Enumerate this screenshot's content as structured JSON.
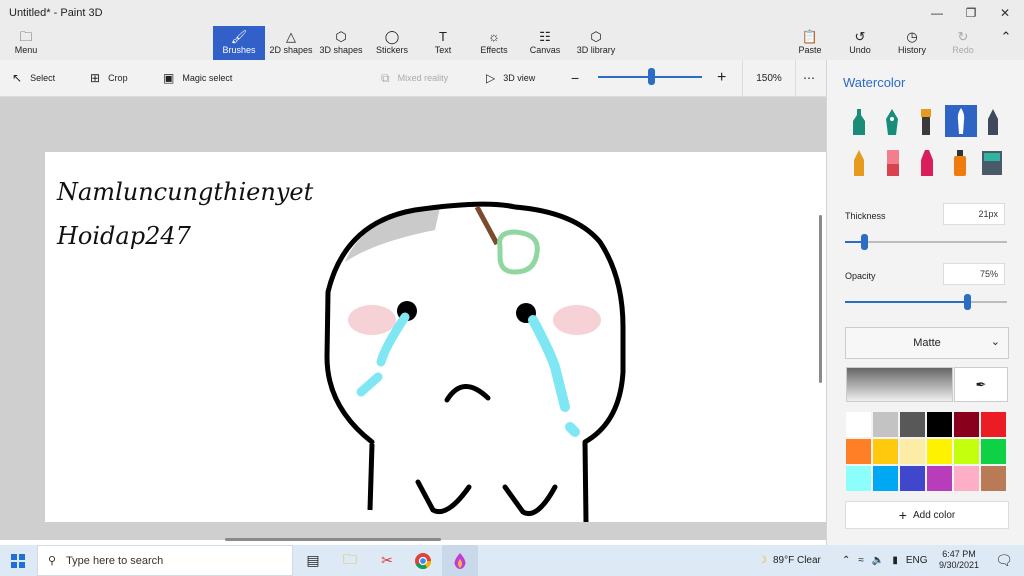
{
  "window": {
    "title": "Untitled* - Paint 3D"
  },
  "ribbon": {
    "menu": "Menu",
    "brushes": "Brushes",
    "shapes2d": "2D shapes",
    "shapes3d": "3D shapes",
    "stickers": "Stickers",
    "text": "Text",
    "effects": "Effects",
    "canvas": "Canvas",
    "library3d": "3D library",
    "paste": "Paste",
    "undo": "Undo",
    "history": "History",
    "redo": "Redo"
  },
  "toolbar": {
    "select": "Select",
    "crop": "Crop",
    "magic_select": "Magic select",
    "mixed_reality": "Mixed reality",
    "view3d": "3D view",
    "zoom": "150%"
  },
  "canvas": {
    "line1": "Namluncungthienyet",
    "line2": "Hoidap247"
  },
  "panel": {
    "title": "Watercolor",
    "thickness_label": "Thickness",
    "thickness_value": "21px",
    "opacity_label": "Opacity",
    "opacity_value": "75%",
    "thickness_level": 0.12,
    "opacity_level": 0.75,
    "finish": "Matte",
    "add_color": "Add color",
    "brush_icons": [
      "marker",
      "calligraphy-pen",
      "oil-brush",
      "watercolor",
      "pencil",
      "crayon",
      "eraser",
      "highlighter",
      "spray-can",
      "fill-bucket"
    ],
    "swatches": [
      "#ffffff",
      "#c3c3c3",
      "#585858",
      "#000000",
      "#88001b",
      "#ec1c24",
      "#ff7f27",
      "#ffc90e",
      "#fdeca6",
      "#fff200",
      "#c4ff0e",
      "#0ed145",
      "#8cfffb",
      "#00a8f3",
      "#3f48cc",
      "#b83dba",
      "#ffaec8",
      "#b97a56"
    ]
  },
  "taskbar": {
    "search_placeholder": "Type here to search",
    "weather": "89°F  Clear",
    "lang": "ENG",
    "time": "6:47 PM",
    "date": "9/30/2021"
  }
}
